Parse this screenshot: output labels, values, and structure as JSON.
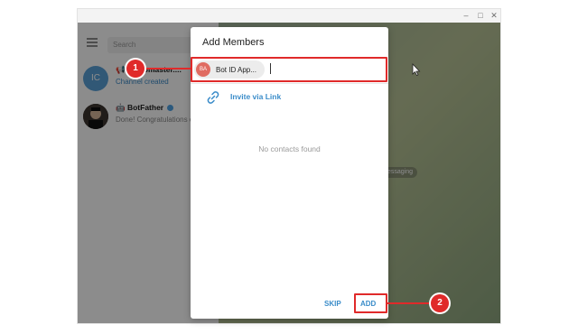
{
  "window": {
    "minimize": "‒",
    "maximize": "□",
    "close": "✕"
  },
  "sidebar": {
    "search_placeholder": "Search",
    "chats": [
      {
        "avatar": "IC",
        "name": "Webpmaster....",
        "subtitle": "Channel created"
      },
      {
        "name": "BotFather",
        "subtitle": "Done! Congratulations o"
      }
    ]
  },
  "chat_area": {
    "status_pill": "messaging"
  },
  "dialog": {
    "title": "Add Members",
    "chip": {
      "avatar": "BA",
      "label": "Bot ID App..."
    },
    "invite_label": "Invite via Link",
    "empty_text": "No contacts found",
    "skip": "SKIP",
    "add": "ADD"
  },
  "annotations": {
    "marker1": "1",
    "marker2": "2",
    "color": "#e02a2a"
  }
}
